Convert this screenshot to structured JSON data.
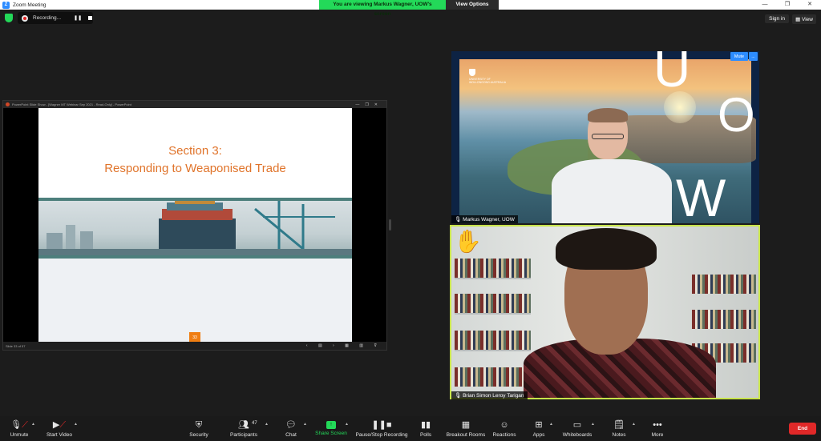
{
  "window": {
    "title": "Zoom Meeting",
    "controls": [
      "—",
      "❐",
      "✕"
    ]
  },
  "banner": {
    "message": "You are viewing Markus Wagner, UOW's screen",
    "view_options": "View Options"
  },
  "recording": {
    "label": "Recording..."
  },
  "topright": {
    "sign_in": "Sign in",
    "view": "View"
  },
  "share": {
    "window_title": "PowerPoint Slide Show - [Wagner MT Webinar Sep 2021 - Read-Only] - PowerPoint",
    "slide_title": "Section 3:",
    "slide_subtitle": "Responding to Weaponised Trade",
    "slide_number": "33",
    "status_left": "Slide 33 of 57"
  },
  "tiles": {
    "speaker1": {
      "name": "Markus Wagner, UOW",
      "mute_label": "Mute",
      "more_label": "...",
      "logo_text": "UNIVERSITY OF WOLLONGONG AUSTRALIA",
      "letters": [
        "U",
        "O",
        "W"
      ]
    },
    "speaker2": {
      "name": "Brian Simon Leroy Tarigan",
      "reaction": "✋"
    }
  },
  "toolbar": {
    "unmute": "Unmute",
    "start_video": "Start Video",
    "security": "Security",
    "participants": "Participants",
    "participant_count": "47",
    "chat": "Chat",
    "share_screen": "Share Screen",
    "pause_recording": "Pause/Stop Recording",
    "polls": "Polls",
    "breakout_rooms": "Breakout Rooms",
    "reactions": "Reactions",
    "apps": "Apps",
    "whiteboards": "Whiteboards",
    "notes": "Notes",
    "more": "More",
    "end": "End"
  },
  "colors": {
    "accent": "#2d8cff",
    "share_green": "#23d959",
    "end_red": "#e02828",
    "slide_orange": "#e0742b",
    "active_speaker": "#c8e44a"
  }
}
